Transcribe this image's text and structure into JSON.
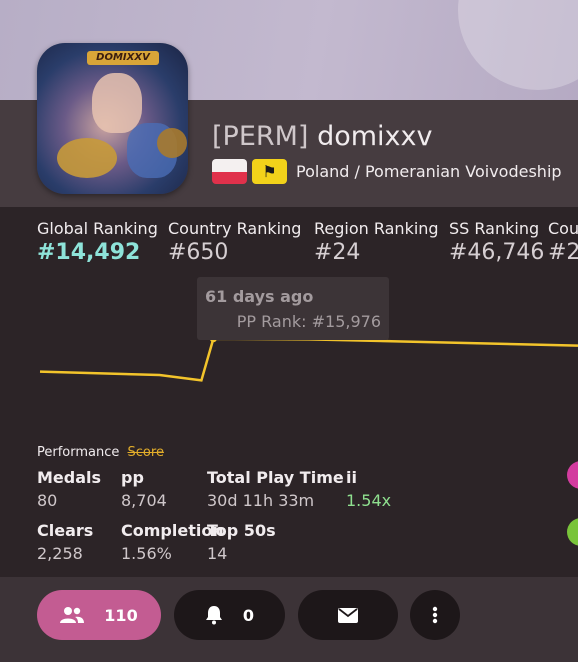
{
  "profile": {
    "tag": "[PERM]",
    "username": "domixxv",
    "location": "Poland / Pomeranian Voivodeship",
    "avatar_text": "DOMIXXV"
  },
  "rankings": [
    {
      "label": "Global Ranking",
      "value": "#14,492"
    },
    {
      "label": "Country Ranking",
      "value": "#650"
    },
    {
      "label": "Region Ranking",
      "value": "#24"
    },
    {
      "label": "SS Ranking",
      "value": "#46,746"
    },
    {
      "label": "Cou",
      "value": "#2"
    }
  ],
  "tooltip": {
    "when": "61 days ago",
    "pp_rank": "PP Rank: #15,976"
  },
  "chart_data": {
    "type": "line",
    "series": [
      {
        "values": [
          {
            "days_ago": 90,
            "rank": 16470
          },
          {
            "days_ago": 70,
            "rank": 16520
          },
          {
            "days_ago": 63,
            "rank": 16600
          },
          {
            "days_ago": 61,
            "rank": 15976
          },
          {
            "days_ago": 45,
            "rank": 15985
          },
          {
            "days_ago": 0,
            "rank": 16080
          }
        ]
      }
    ],
    "x_range": [
      90,
      0
    ],
    "y_range": [
      16700,
      15800
    ],
    "line_color": "#f3c42b"
  },
  "performance": {
    "title": "Performance",
    "alt": "Score"
  },
  "stats": [
    {
      "label": "Medals",
      "value": "80"
    },
    {
      "label": "pp",
      "value": "8,704"
    },
    {
      "label": "Total Play Time",
      "value": "30d 11h 33m"
    },
    {
      "label": "ii",
      "value": "1.54x"
    },
    {
      "label": "Clears",
      "value": "2,258"
    },
    {
      "label": "Completion",
      "value": "1.56%"
    },
    {
      "label": "Top 50s",
      "value": "14"
    }
  ],
  "buttons": {
    "friends": "110",
    "notifications": "0"
  },
  "colors": {
    "accent_pink": "#c35c92",
    "highlight": "#8ee3d9",
    "line": "#f3c42b",
    "green": "#8fe08f"
  }
}
